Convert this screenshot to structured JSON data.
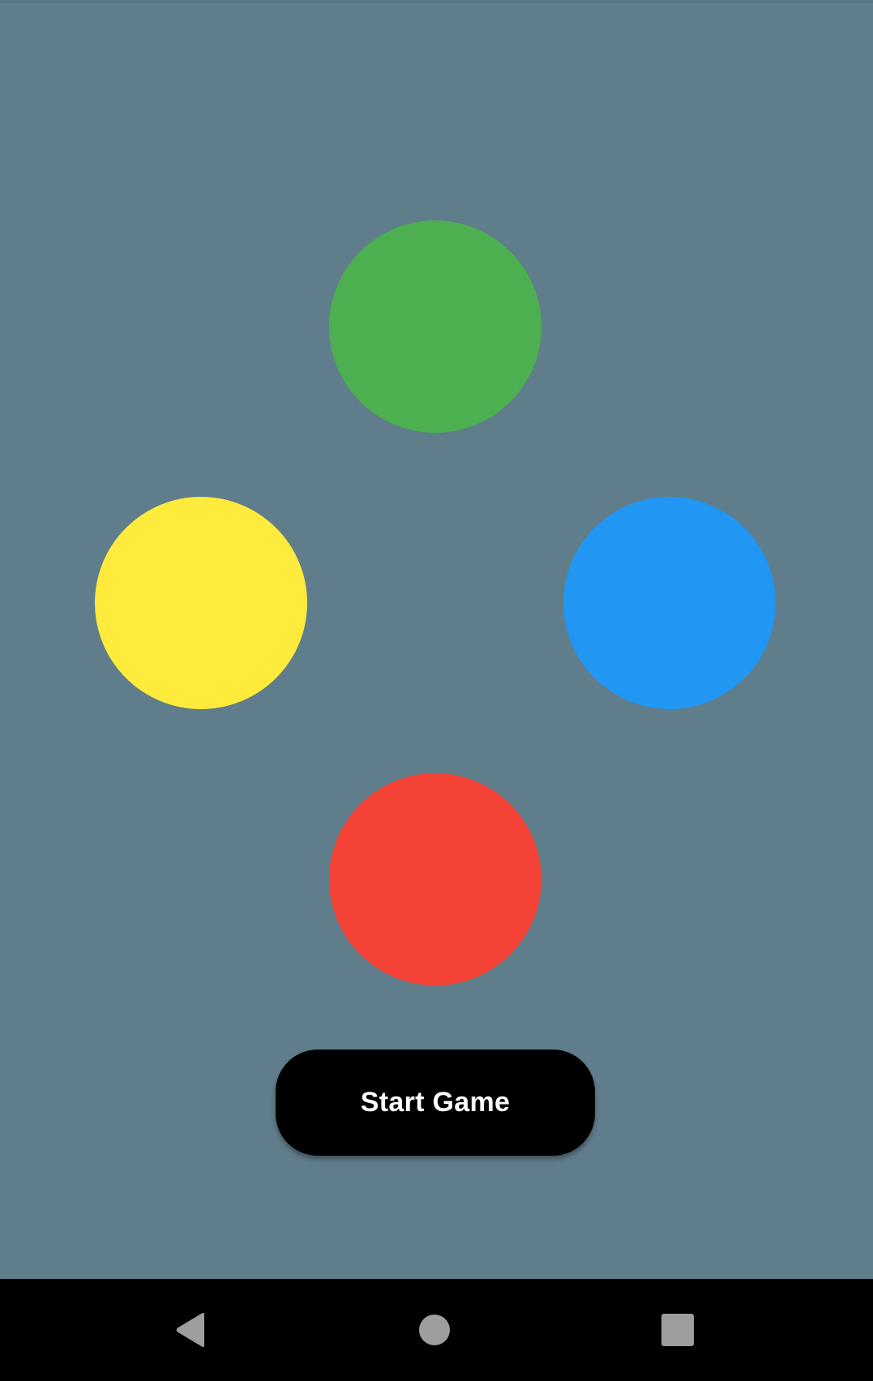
{
  "game": {
    "pads": [
      {
        "id": "green",
        "color": "#4caf50"
      },
      {
        "id": "yellow",
        "color": "#ffeb3b"
      },
      {
        "id": "blue",
        "color": "#2196f3"
      },
      {
        "id": "red",
        "color": "#f44336"
      }
    ],
    "start_button": {
      "label": "Start Game",
      "background": "#000000"
    }
  },
  "system_nav": {
    "background": "#000000",
    "icon_color": "#9e9e9e",
    "buttons": [
      {
        "name": "back",
        "icon": "triangle-back-icon"
      },
      {
        "name": "home",
        "icon": "circle-home-icon"
      },
      {
        "name": "recent",
        "icon": "square-recents-icon"
      }
    ]
  },
  "theme": {
    "background": "#607d8b"
  }
}
